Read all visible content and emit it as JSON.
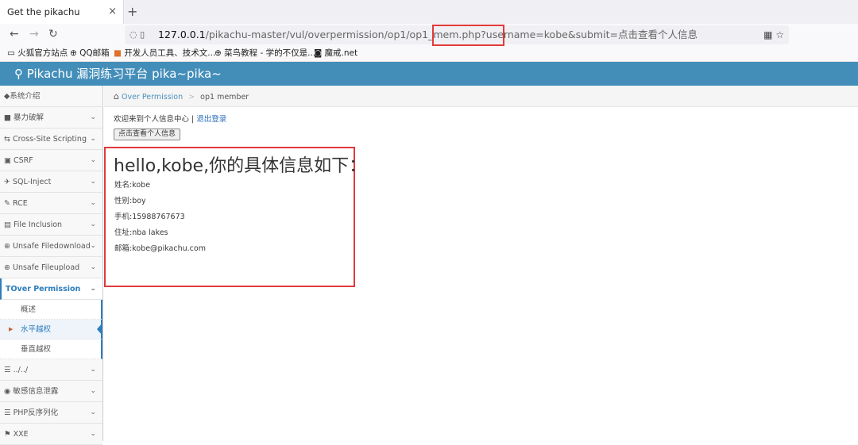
{
  "browser": {
    "tab_title": "Get the pikachu",
    "tab_close": "×",
    "new_tab": "+",
    "back": "←",
    "forward": "→",
    "reload": "↻",
    "url_host": "127.0.0.1",
    "url_rest": "/pikachu-master/vul/overpermission/op1/op1_mem.php?username=kobe&submit=点击查看个人信息",
    "bookmarks": [
      "火狐官方站点",
      "QQ邮箱",
      "开发人员工具、技术文...",
      "菜鸟教程 - 学的不仅是...",
      "魔戒.net"
    ]
  },
  "app": {
    "title": "Pikachu 漏洞练习平台 pika~pika~"
  },
  "sidebar": {
    "items": [
      {
        "icon": "◆",
        "label": "系统介绍",
        "chev": ""
      },
      {
        "icon": "■",
        "label": "暴力破解",
        "chev": "⌄"
      },
      {
        "icon": "⇆",
        "label": "Cross-Site Scripting",
        "chev": "⌄"
      },
      {
        "icon": "▣",
        "label": "CSRF",
        "chev": "⌄"
      },
      {
        "icon": "✈",
        "label": "SQL-Inject",
        "chev": "⌄"
      },
      {
        "icon": "✎",
        "label": "RCE",
        "chev": "⌄"
      },
      {
        "icon": "▤",
        "label": "File Inclusion",
        "chev": "⌄"
      },
      {
        "icon": "⊕",
        "label": "Unsafe Filedownload",
        "chev": "⌄"
      },
      {
        "icon": "⊕",
        "label": "Unsafe Fileupload",
        "chev": "⌄"
      }
    ],
    "active": {
      "icon": "T",
      "label": "Over Permission",
      "chev": "⌄"
    },
    "subitems": [
      "概述",
      "水平越权",
      "垂直越权"
    ],
    "items_after": [
      {
        "icon": "☰",
        "label": "../../",
        "chev": "⌄"
      },
      {
        "icon": "◉",
        "label": "敏感信息泄露",
        "chev": "⌄"
      },
      {
        "icon": "☰",
        "label": "PHP反序列化",
        "chev": "⌄"
      },
      {
        "icon": "⚑",
        "label": "XXE",
        "chev": "⌄"
      }
    ]
  },
  "breadcrumb": {
    "section": "Over Permission",
    "separator": ">",
    "page": "op1 member"
  },
  "main": {
    "welcome": "欢迎来到个人信息中心",
    "sep": "|",
    "logout": "退出登录",
    "view_button": "点击查看个人信息",
    "info_title": "hello,kobe,你的具体信息如下：",
    "info_lines": [
      "姓名:kobe",
      "性别:boy",
      "手机:15988767673",
      "住址:nba lakes",
      "邮箱:kobe@pikachu.com"
    ]
  }
}
